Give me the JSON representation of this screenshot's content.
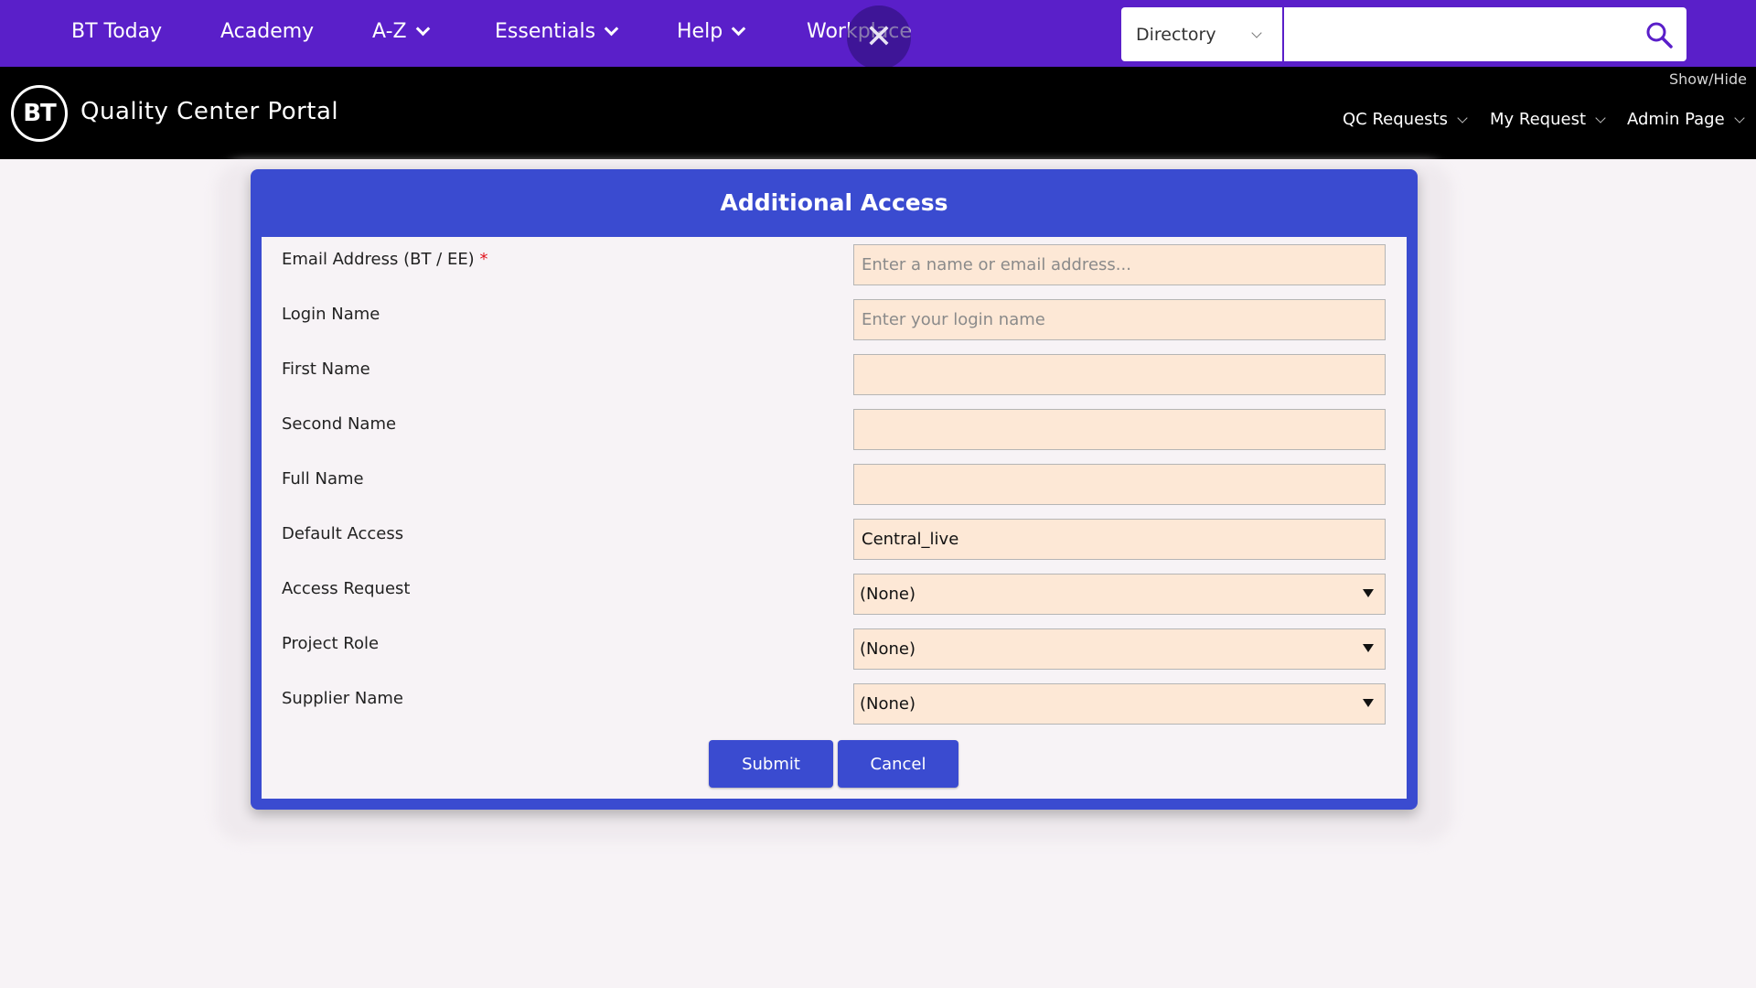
{
  "topnav": {
    "items": [
      {
        "label": "BT Today"
      },
      {
        "label": "Academy"
      },
      {
        "label": "A-Z"
      },
      {
        "label": "Essentials"
      },
      {
        "label": "Help"
      },
      {
        "label": "Workplace"
      }
    ],
    "directory_label": "Directory",
    "search_value": "",
    "close_icon": "close-icon",
    "search_icon": "search-icon"
  },
  "header": {
    "logo_text": "BT",
    "title": "Quality Center Portal",
    "show_hide": "Show/Hide",
    "menus": [
      {
        "label": "QC Requests"
      },
      {
        "label": "My Request"
      },
      {
        "label": "Admin Page"
      }
    ]
  },
  "dialog": {
    "title": "Additional Access",
    "fields": {
      "email": {
        "label": "Email Address (BT / EE)",
        "required_mark": "*",
        "value": "",
        "placeholder": "Enter a name or email address..."
      },
      "login": {
        "label": "Login Name",
        "value": "",
        "placeholder": "Enter your login name"
      },
      "first_name": {
        "label": "First Name",
        "value": ""
      },
      "second_name": {
        "label": "Second Name",
        "value": ""
      },
      "full_name": {
        "label": "Full Name",
        "value": ""
      },
      "default_access": {
        "label": "Default Access",
        "value": "Central_live"
      },
      "access_request": {
        "label": "Access Request",
        "value": "(None)"
      },
      "project_role": {
        "label": "Project Role",
        "value": "(None)"
      },
      "supplier_name": {
        "label": "Supplier Name",
        "value": "(None)"
      }
    },
    "submit_label": "Submit",
    "cancel_label": "Cancel"
  },
  "colors": {
    "topbar": "#5a1fc9",
    "header": "#000000",
    "dialog_accent": "#3a4bd0",
    "input_bg": "#fde8d6",
    "required": "#e0141e"
  }
}
